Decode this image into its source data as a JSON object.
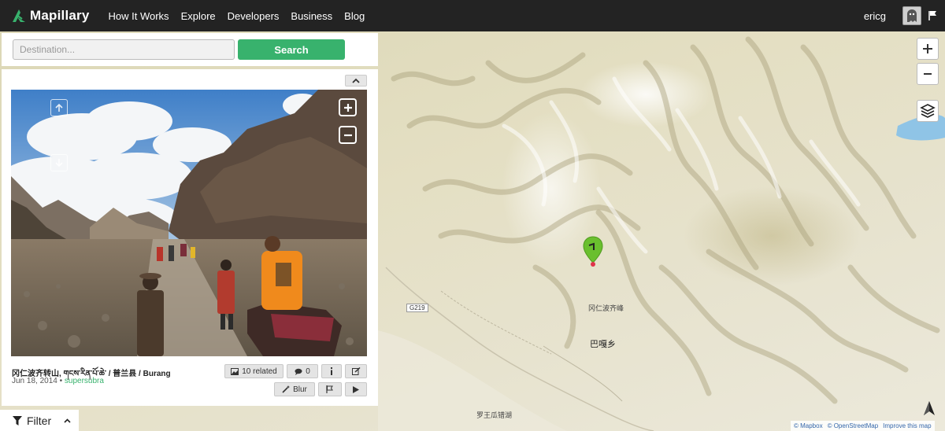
{
  "app": {
    "brand": "Mapillary",
    "accent_color": "#38b26d",
    "nav_items": [
      {
        "label": "How It Works"
      },
      {
        "label": "Explore"
      },
      {
        "label": "Developers"
      },
      {
        "label": "Business"
      },
      {
        "label": "Blog"
      }
    ],
    "username": "ericg",
    "icons": {
      "avatar": "ghost-avatar-icon",
      "flag": "flag-icon",
      "logo": "mapillary-logo-icon"
    }
  },
  "search": {
    "placeholder": "Destination...",
    "value": "",
    "button_label": "Search"
  },
  "photo": {
    "title": "冈仁波齐转山, གངས་རིན་པོ་ཆེ་ / 普兰县 / Burang",
    "date": "Jun 18, 2014",
    "separator": "•",
    "user": "supersubra",
    "related_label": "10 related",
    "comments_count": "0",
    "blur_label": "Blur"
  },
  "filter": {
    "label": "Filter"
  },
  "map": {
    "labels": {
      "peak": "冈仁波齐峰",
      "town": "巴嘎乡",
      "lake": "罗王瓜错湖",
      "road": "G219"
    },
    "attribution": {
      "mapbox": "© Mapbox",
      "osm": "© OpenStreetMap",
      "improve": "Improve this map"
    },
    "marker_color": "#6abf2e"
  }
}
